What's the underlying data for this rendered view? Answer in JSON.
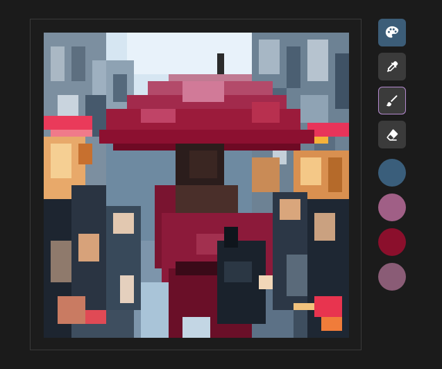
{
  "toolbar": {
    "tools": [
      {
        "id": "palette",
        "icon": "palette-icon",
        "active": true
      },
      {
        "id": "eyedropper",
        "icon": "eyedropper-icon",
        "active": false
      },
      {
        "id": "brush",
        "icon": "brush-icon",
        "active": false,
        "selected": true
      },
      {
        "id": "eraser",
        "icon": "eraser-icon",
        "active": false
      }
    ]
  },
  "palette": {
    "swatches": [
      "#3a5e7b",
      "#a05f86",
      "#8b0f2c",
      "#8a5c76"
    ]
  },
  "canvas": {
    "image": "pixel-art-woman-with-red-umbrella-in-rainy-street"
  },
  "colors": {
    "accent": "#3c5d78",
    "selection_border": "#b58ad0",
    "tool_bg": "#3b3b3b",
    "app_bg": "#1b1b1b"
  }
}
